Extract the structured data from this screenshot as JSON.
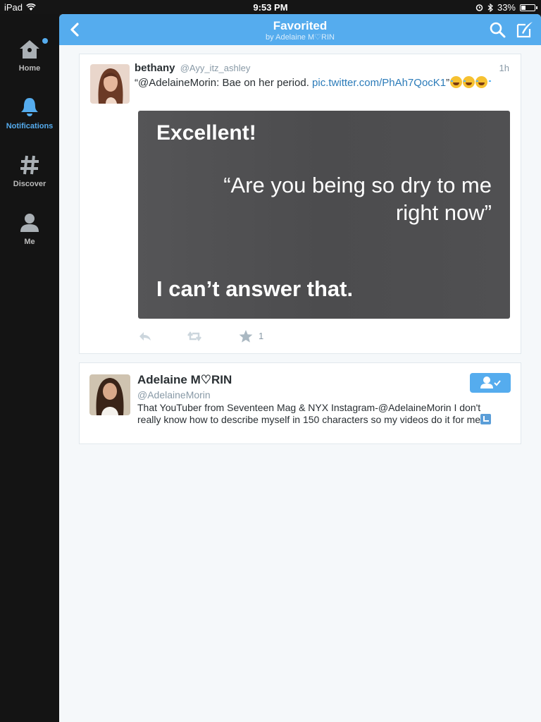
{
  "status_bar": {
    "device": "iPad",
    "time": "9:53 PM",
    "battery": "33%",
    "battery_level": 0.33
  },
  "sidebar": {
    "items": [
      {
        "label": "Home",
        "icon": "home-icon",
        "has_badge": true
      },
      {
        "label": "Notifications",
        "icon": "bell-icon",
        "active": true
      },
      {
        "label": "Discover",
        "icon": "hashtag-icon"
      },
      {
        "label": "Me",
        "icon": "person-icon"
      }
    ]
  },
  "header": {
    "title": "Favorited",
    "subtitle": "by Adelaine M♡RIN"
  },
  "tweet": {
    "name": "bethany",
    "handle": "@Ayy_itz_ashley",
    "time": "1h",
    "text_prefix": "“@AdelaineMorin: Bae on her period. ",
    "link": "pic.twitter.com/PhAh7QocK1",
    "text_suffix": "”",
    "media": {
      "line1": "Excellent!",
      "line2": "“Are you being so dry to me right now”",
      "line3": "I can’t answer that."
    },
    "favorite_count": "1"
  },
  "profile": {
    "name": "Adelaine M♡RIN",
    "handle": "@AdelaineMorin",
    "bio": "That YouTuber from Seventeen Mag & NYX Instagram-@AdelaineMorin I don't really know how to describe myself in 150 characters so my videos do it for me"
  },
  "colors": {
    "accent": "#55acee",
    "sidebar_bg": "#141414",
    "link": "#2b7bb9"
  }
}
